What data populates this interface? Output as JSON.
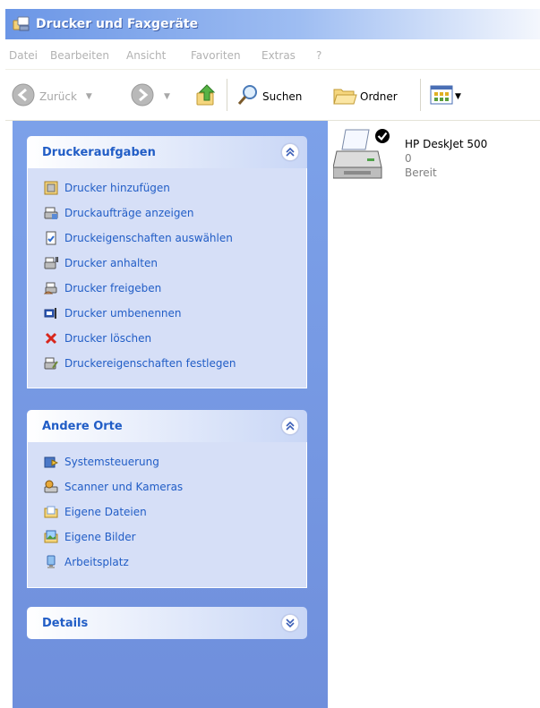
{
  "window": {
    "title": "Drucker und Faxgeräte"
  },
  "menu": [
    "Datei",
    "Bearbeiten",
    "Ansicht",
    "Favoriten",
    "Extras",
    "?"
  ],
  "toolbar": {
    "back": "Zurück",
    "search": "Suchen",
    "folders": "Ordner"
  },
  "panels": {
    "printer_tasks": {
      "title": "Druckeraufgaben",
      "items": [
        {
          "label": "Drucker hinzufügen",
          "icon": "add-printer-icon"
        },
        {
          "label": "Druckaufträge anzeigen",
          "icon": "print-queue-icon"
        },
        {
          "label": "Druckeigenschaften auswählen",
          "icon": "preferences-icon"
        },
        {
          "label": "Drucker anhalten",
          "icon": "pause-printer-icon"
        },
        {
          "label": "Drucker freigeben",
          "icon": "share-printer-icon"
        },
        {
          "label": "Drucker umbenennen",
          "icon": "rename-icon"
        },
        {
          "label": "Drucker löschen",
          "icon": "delete-icon"
        },
        {
          "label": "Druckereigenschaften festlegen",
          "icon": "printer-properties-icon"
        }
      ]
    },
    "other_places": {
      "title": "Andere Orte",
      "items": [
        {
          "label": "Systemsteuerung",
          "icon": "control-panel-icon"
        },
        {
          "label": "Scanner und Kameras",
          "icon": "scanner-icon"
        },
        {
          "label": "Eigene Dateien",
          "icon": "my-documents-icon"
        },
        {
          "label": "Eigene Bilder",
          "icon": "my-pictures-icon"
        },
        {
          "label": "Arbeitsplatz",
          "icon": "my-computer-icon"
        }
      ]
    },
    "details": {
      "title": "Details"
    }
  },
  "printer": {
    "name": "HP DeskJet 500",
    "jobs": "0",
    "status": "Bereit"
  }
}
